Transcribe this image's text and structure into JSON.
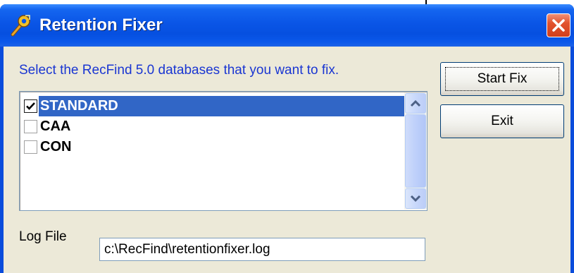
{
  "window": {
    "title": "Retention Fixer",
    "title_icon": "wrench-key-icon",
    "close_icon": "close-icon"
  },
  "instruction": "Select the RecFind 5.0 databases that you want to fix.",
  "databases": [
    {
      "label": "STANDARD",
      "checked": true,
      "selected": true
    },
    {
      "label": "CAA",
      "checked": false,
      "selected": false
    },
    {
      "label": "CON",
      "checked": false,
      "selected": false
    }
  ],
  "buttons": {
    "start_fix": "Start Fix",
    "exit": "Exit"
  },
  "log": {
    "label": "Log File",
    "value": "c:\\RecFind\\retentionfixer.log"
  },
  "colors": {
    "titlebar": "#0a55e6",
    "selection": "#3166c6",
    "instruction_text": "#1a36d2",
    "dialog_face": "#ece9d8",
    "close_button": "#e2532e"
  }
}
